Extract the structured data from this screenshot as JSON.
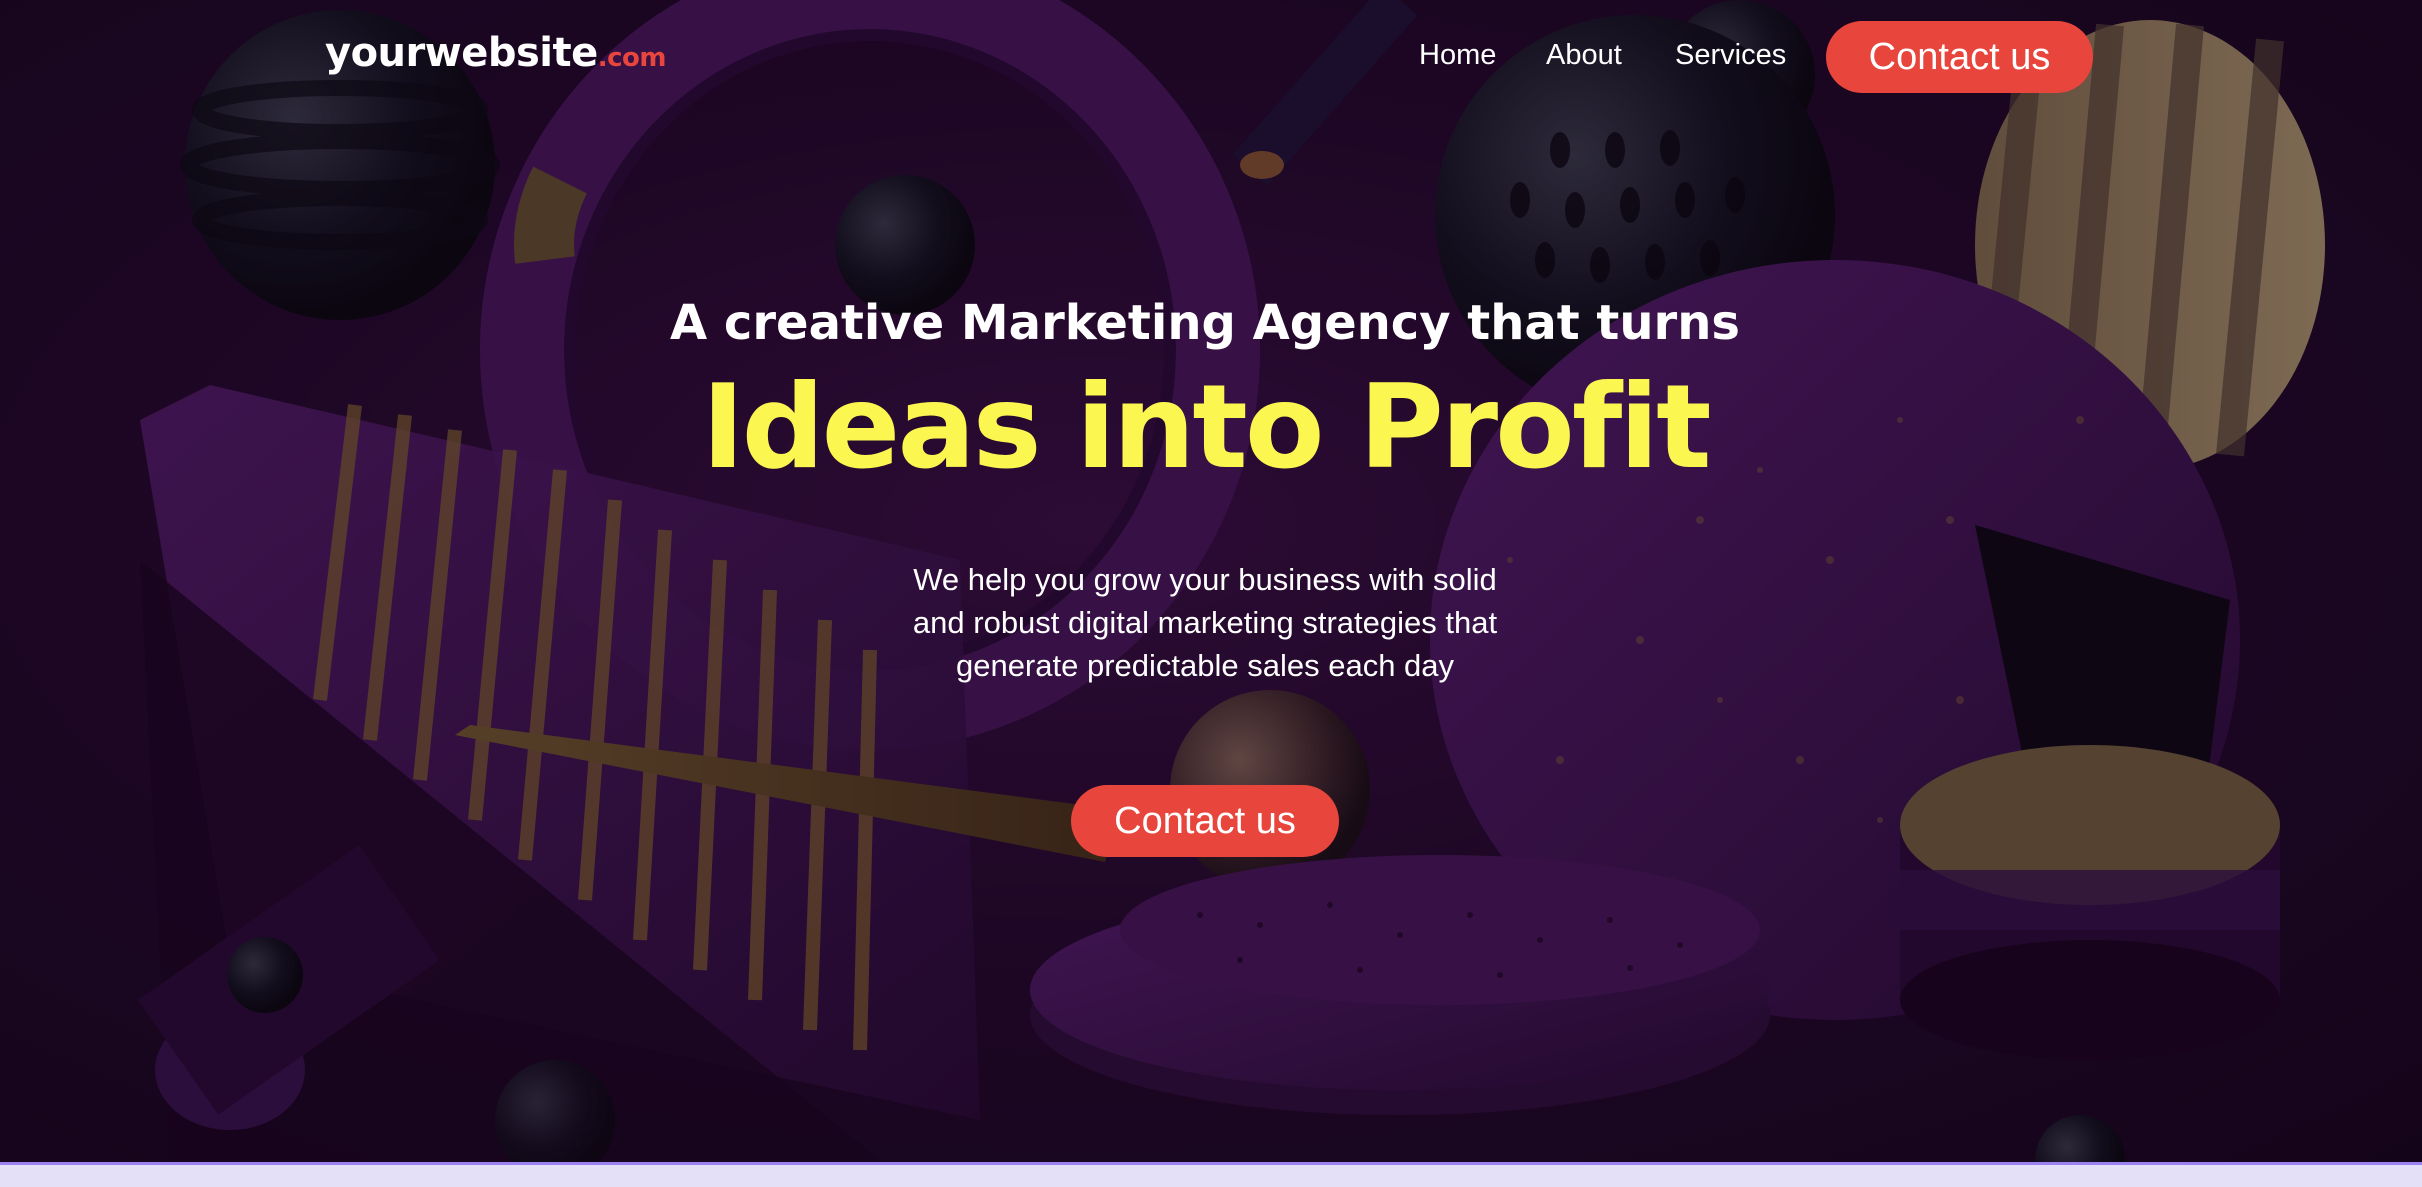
{
  "nav": {
    "logo_main": "yourwebsite",
    "logo_tld": ".com",
    "links": [
      "Home",
      "About",
      "Services"
    ],
    "cta_label": "Contact us"
  },
  "hero": {
    "tagline": "A creative Marketing Agency that turns",
    "headline": "Ideas into Profit",
    "subtext_lines": [
      "We help you grow your business with solid",
      "and robust digital marketing strategies that",
      "generate predictable sales each day"
    ],
    "cta_label": "Contact us"
  },
  "colors": {
    "accent": "#e8453c",
    "headline": "#fcf651",
    "background": "#240a2e",
    "footer_strip": "#e4e0f8"
  }
}
